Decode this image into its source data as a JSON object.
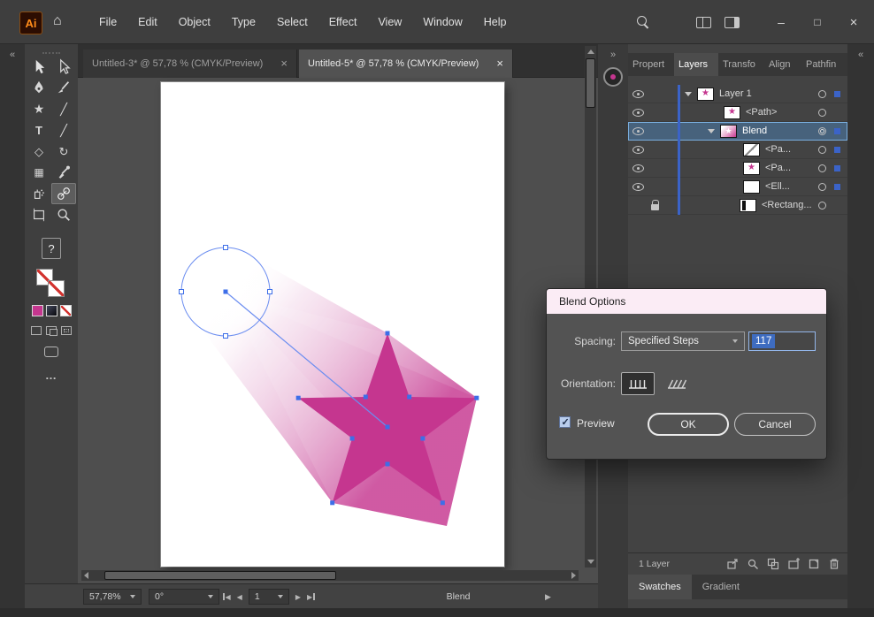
{
  "colors": {
    "star_pink": "#c5368f",
    "path_blue": "#6b8df0",
    "anchor_blue": "#3d6ee8",
    "accent_blue": "#3b63c8",
    "dialog_header_bg": "#fbecf5",
    "selected_row_bg": "#47627c",
    "selected_row_border": "#79aede"
  },
  "titlebar": {
    "logo": "Ai",
    "menu": [
      "File",
      "Edit",
      "Object",
      "Type",
      "Select",
      "Effect",
      "View",
      "Window",
      "Help"
    ]
  },
  "glyphs": {
    "home": "⌂",
    "minimize": "–",
    "maximize": "□",
    "close": "×",
    "tab_close": "×",
    "collapse": "«",
    "expand": "»",
    "question": "?",
    "more": "…",
    "star": "★",
    "type": "T",
    "line": "╱",
    "pencil": "╱",
    "eraser": "◇",
    "rotate": "↻",
    "mesh": "▦",
    "prev": "◀",
    "next": "▶"
  },
  "tabs": [
    {
      "title": "Untitled-3* @ 57,78 % (CMYK/Preview)"
    },
    {
      "title": "Untitled-5* @ 57,78 % (CMYK/Preview)"
    }
  ],
  "tools": [
    "selection",
    "direct-selection",
    "pen",
    "paintbrush",
    "star-shape",
    "pencil",
    "type",
    "line-segment",
    "eraser",
    "rotate",
    "mesh",
    "eyedropper",
    "symbol-sprayer",
    "blend",
    "artboard",
    "zoom"
  ],
  "layers": {
    "tabs": [
      "Propert",
      "Layers",
      "Transfo",
      "Align",
      "Pathfin"
    ],
    "rows": [
      {
        "label": "Layer 1"
      },
      {
        "label": "<Path>"
      },
      {
        "label": "Blend"
      },
      {
        "label": "<Pa..."
      },
      {
        "label": "<Pa..."
      },
      {
        "label": "<Ell..."
      },
      {
        "label": "<Rectang..."
      }
    ],
    "footer": "1 Layer"
  },
  "panel_bottom": {
    "swatches": "Swatches",
    "gradient": "Gradient"
  },
  "dialog": {
    "title": "Blend Options",
    "spacing_label": "Spacing:",
    "spacing_value": "Specified Steps",
    "steps_value": "117",
    "orientation_label": "Orientation:",
    "preview_label": "Preview",
    "ok_label": "OK",
    "cancel_label": "Cancel"
  },
  "statusbar": {
    "zoom": "57,78%",
    "rotation": "0°",
    "artboard_number": "1",
    "status": "Blend"
  }
}
